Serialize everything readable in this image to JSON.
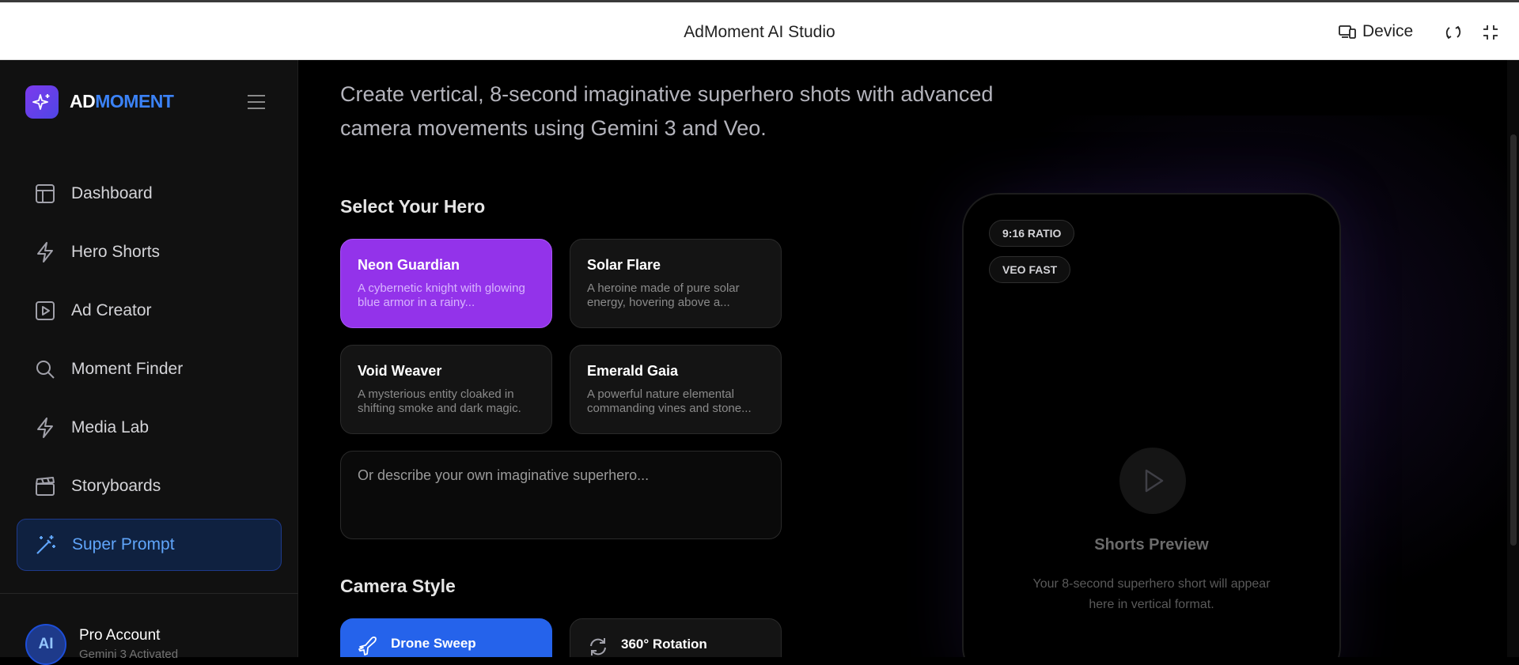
{
  "topbar": {
    "title": "AdMoment AI Studio",
    "device_label": "Device"
  },
  "sidebar": {
    "logo_part1": "AD",
    "logo_part2": "MOMENT",
    "items": [
      {
        "label": "Dashboard",
        "icon": "layout-icon"
      },
      {
        "label": "Hero Shorts",
        "icon": "bolt-icon"
      },
      {
        "label": "Ad Creator",
        "icon": "play-square-icon"
      },
      {
        "label": "Moment Finder",
        "icon": "search-icon"
      },
      {
        "label": "Media Lab",
        "icon": "bolt-icon"
      },
      {
        "label": "Storyboards",
        "icon": "clapperboard-icon"
      },
      {
        "label": "Super Prompt",
        "icon": "magic-wand-icon",
        "active": true
      }
    ],
    "account": {
      "initials": "AI",
      "name": "Pro Account",
      "status": "Gemini 3 Activated"
    }
  },
  "main": {
    "intro": "Create vertical, 8-second imaginative superhero shots with advanced camera movements using Gemini 3 and Veo.",
    "hero_section_title": "Select Your Hero",
    "heroes": [
      {
        "name": "Neon Guardian",
        "desc": "A cybernetic knight with glowing blue armor in a rainy...",
        "selected": true
      },
      {
        "name": "Solar Flare",
        "desc": "A heroine made of pure solar energy, hovering above a..."
      },
      {
        "name": "Void Weaver",
        "desc": "A mysterious entity cloaked in shifting smoke and dark magic."
      },
      {
        "name": "Emerald Gaia",
        "desc": "A powerful nature elemental commanding vines and stone..."
      }
    ],
    "custom_placeholder": "Or describe your own imaginative superhero...",
    "camera_section_title": "Camera Style",
    "camera_styles": [
      {
        "label": "Drone Sweep",
        "icon": "plane-icon",
        "selected": true
      },
      {
        "label": "360° Rotation",
        "icon": "rotate-icon"
      }
    ]
  },
  "preview": {
    "badge_ratio": "9:16 RATIO",
    "badge_model": "VEO FAST",
    "title": "Shorts Preview",
    "desc": "Your 8-second superhero short will appear here in vertical format."
  },
  "colors": {
    "accent_blue": "#2563eb",
    "accent_purple": "#9333ea",
    "active_nav_text": "#60a5fa"
  }
}
